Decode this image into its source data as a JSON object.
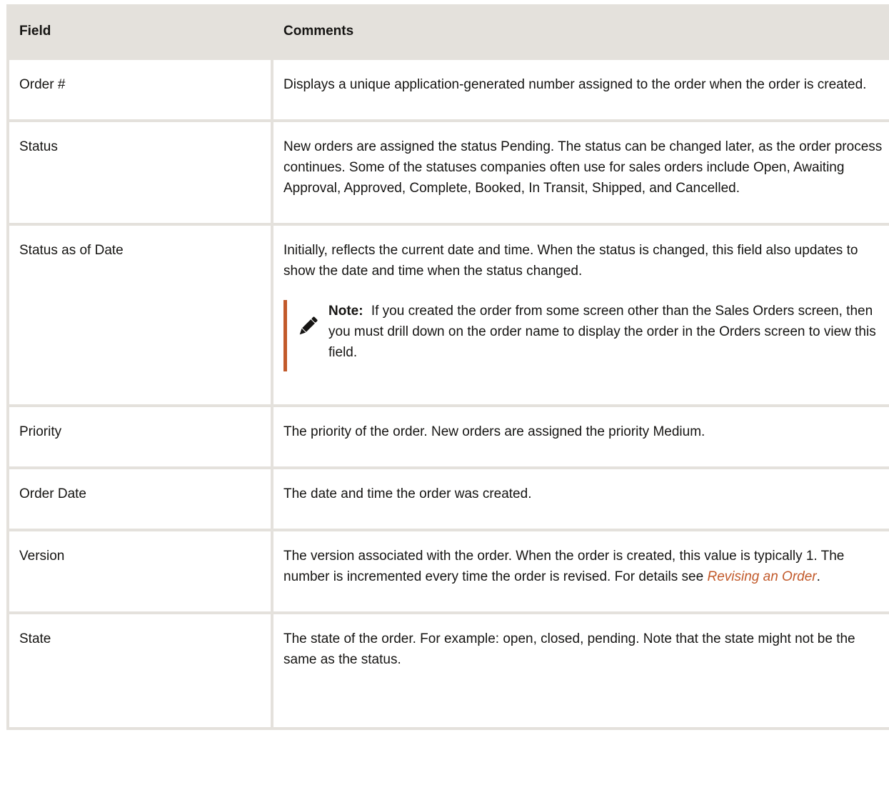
{
  "table": {
    "headers": {
      "field": "Field",
      "comments": "Comments"
    },
    "rows": [
      {
        "field": "Order #",
        "comment": "Displays a unique application-generated number assigned to the order when the order is created."
      },
      {
        "field": "Status",
        "comment": "New orders are assigned the status Pending. The status can be changed later, as the order process continues. Some of the statuses companies often use for sales orders include Open, Awaiting Approval, Approved, Complete, Booked, In Transit, Shipped, and Cancelled."
      },
      {
        "field": "Status as of Date",
        "comment": "Initially, reflects the current date and time. When the status is changed, this field also updates to show the date and time when the status changed.",
        "note": {
          "label": "Note:",
          "text": "If you created the order from some screen other than the Sales Orders screen, then you must drill down on the order name to display the order in the Orders screen to view this field.",
          "icon": "pencil-icon"
        }
      },
      {
        "field": "Priority",
        "comment": "The priority of the order. New orders are assigned the priority Medium."
      },
      {
        "field": "Order Date",
        "comment": "The date and time the order was created."
      },
      {
        "field": "Version",
        "comment_before": "The version associated with the order. When the order is created, this value is typically 1. The number is incremented every time the order is revised. For details see ",
        "link": "Revising an Order",
        "comment_after": "."
      },
      {
        "field": "State",
        "comment": "The state of the order. For example: open, closed, pending. Note that the state might not be the same as the status."
      }
    ]
  },
  "colors": {
    "header_bg": "#e4e1dc",
    "accent": "#c25a2b",
    "text": "#161513"
  }
}
